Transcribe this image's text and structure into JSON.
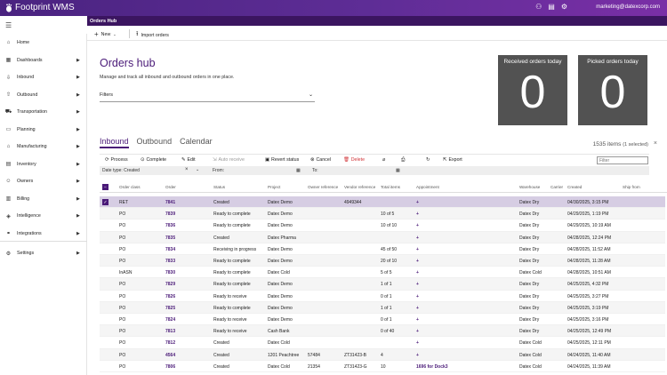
{
  "app": {
    "title": "Footprint WMS",
    "email": "marketing@datexcorp.com"
  },
  "topicons": [
    "user-switch-icon",
    "document-icon",
    "gear-icon"
  ],
  "page_header": "Orders Hub",
  "sidebar": {
    "items": [
      {
        "label": "Home",
        "icon": "home-icon",
        "arrow": false
      },
      {
        "label": "Dashboards",
        "icon": "dashboard-icon",
        "arrow": true
      },
      {
        "label": "Inbound",
        "icon": "inbound-icon",
        "arrow": true
      },
      {
        "label": "Outbound",
        "icon": "outbound-icon",
        "arrow": true
      },
      {
        "label": "Transportation",
        "icon": "truck-icon",
        "arrow": true
      },
      {
        "label": "Planning",
        "icon": "planning-icon",
        "arrow": true
      },
      {
        "label": "Manufacturing",
        "icon": "factory-icon",
        "arrow": true
      },
      {
        "label": "Inventory",
        "icon": "inventory-icon",
        "arrow": true
      },
      {
        "label": "Owners",
        "icon": "owners-icon",
        "arrow": true
      },
      {
        "label": "Billing",
        "icon": "billing-icon",
        "arrow": true
      },
      {
        "label": "Intelligence",
        "icon": "intelligence-icon",
        "arrow": true
      },
      {
        "label": "Integrations",
        "icon": "integrations-icon",
        "arrow": true
      },
      {
        "label": "Settings",
        "icon": "gear-icon",
        "arrow": true
      }
    ]
  },
  "toolbar": {
    "new_label": "New",
    "import_label": "Import orders"
  },
  "hub": {
    "title": "Orders hub",
    "description": "Manage and track all inbound and outbound orders in one place.",
    "filters_label": "Filters"
  },
  "cards": [
    {
      "title": "Received orders today",
      "value": "0"
    },
    {
      "title": "Picked orders today",
      "value": "0"
    }
  ],
  "tabs": [
    {
      "label": "Inbound",
      "active": true
    },
    {
      "label": "Outbound",
      "active": false
    },
    {
      "label": "Calendar",
      "active": false
    }
  ],
  "count": {
    "items": "1535 items",
    "selected": "(1 selected)"
  },
  "grid_toolbar": {
    "process": "Process",
    "complete": "Complete",
    "edit": "Edit",
    "auto_receive": "Auto receive",
    "revert": "Revert status",
    "cancel": "Cancel",
    "delete": "Delete",
    "export": "Export",
    "filter_placeholder": "Filter"
  },
  "criteria": {
    "date_type": "Date type: Created",
    "from": "From:",
    "to": "To:"
  },
  "columns": [
    "Order class",
    "Order",
    "Status",
    "Project",
    "Owner reference",
    "Vendor reference",
    "Total items",
    "Appointment",
    "Warehouse",
    "Carrier",
    "Created",
    "Ship from"
  ],
  "rows": [
    {
      "cls": "RET",
      "order": "7841",
      "status": "Created",
      "project": "Datex Demo",
      "owner_ref": "",
      "vendor_ref": "4949344",
      "items": "",
      "appt": "+",
      "wh": "Datex Dry",
      "created": "04/30/2025, 3:15 PM",
      "selected": true
    },
    {
      "cls": "PO",
      "order": "7839",
      "status": "Ready to complete",
      "project": "Datex Demo",
      "owner_ref": "",
      "vendor_ref": "",
      "items": "10 of 5",
      "appt": "+",
      "wh": "Datex Dry",
      "created": "04/29/2025, 1:19 PM",
      "selected": false
    },
    {
      "cls": "PO",
      "order": "7836",
      "status": "Ready to complete",
      "project": "Datex Demo",
      "owner_ref": "",
      "vendor_ref": "",
      "items": "10 of 10",
      "appt": "+",
      "wh": "Datex Dry",
      "created": "04/29/2025, 10:19 AM",
      "selected": false
    },
    {
      "cls": "PO",
      "order": "7835",
      "status": "Created",
      "project": "Datex Pharma",
      "owner_ref": "",
      "vendor_ref": "",
      "items": "",
      "appt": "+",
      "wh": "Datex Dry",
      "created": "04/28/2025, 12:24 PM",
      "selected": false
    },
    {
      "cls": "PO",
      "order": "7834",
      "status": "Receiving in progress",
      "project": "Datex Demo",
      "owner_ref": "",
      "vendor_ref": "",
      "items": "45 of 50",
      "appt": "+",
      "wh": "Datex Dry",
      "created": "04/28/2025, 11:52 AM",
      "selected": false
    },
    {
      "cls": "PO",
      "order": "7833",
      "status": "Ready to complete",
      "project": "Datex Demo",
      "owner_ref": "",
      "vendor_ref": "",
      "items": "20 of 10",
      "appt": "+",
      "wh": "Datex Dry",
      "created": "04/28/2025, 11:28 AM",
      "selected": false
    },
    {
      "cls": "InASN",
      "order": "7830",
      "status": "Ready to complete",
      "project": "Datex Cold",
      "owner_ref": "",
      "vendor_ref": "",
      "items": "5 of 5",
      "appt": "+",
      "wh": "Datex Cold",
      "created": "04/28/2025, 10:51 AM",
      "selected": false
    },
    {
      "cls": "PO",
      "order": "7829",
      "status": "Ready to complete",
      "project": "Datex Demo",
      "owner_ref": "",
      "vendor_ref": "",
      "items": "1 of 1",
      "appt": "+",
      "wh": "Datex Dry",
      "created": "04/25/2025, 4:32 PM",
      "selected": false
    },
    {
      "cls": "PO",
      "order": "7826",
      "status": "Ready to receive",
      "project": "Datex Demo",
      "owner_ref": "",
      "vendor_ref": "",
      "items": "0 of 1",
      "appt": "+",
      "wh": "Datex Dry",
      "created": "04/25/2025, 3:27 PM",
      "selected": false
    },
    {
      "cls": "PO",
      "order": "7825",
      "status": "Ready to complete",
      "project": "Datex Demo",
      "owner_ref": "",
      "vendor_ref": "",
      "items": "1 of 1",
      "appt": "+",
      "wh": "Datex Dry",
      "created": "04/25/2025, 3:19 PM",
      "selected": false
    },
    {
      "cls": "PO",
      "order": "7824",
      "status": "Ready to receive",
      "project": "Datex Demo",
      "owner_ref": "",
      "vendor_ref": "",
      "items": "0 of 1",
      "appt": "+",
      "wh": "Datex Dry",
      "created": "04/25/2025, 3:16 PM",
      "selected": false
    },
    {
      "cls": "PO",
      "order": "7813",
      "status": "Ready to receive",
      "project": "Cash Bank",
      "owner_ref": "",
      "vendor_ref": "",
      "items": "0 of 40",
      "appt": "+",
      "wh": "Datex Dry",
      "created": "04/25/2025, 12:49 PM",
      "selected": false
    },
    {
      "cls": "PO",
      "order": "7812",
      "status": "Created",
      "project": "Datex Cold",
      "owner_ref": "",
      "vendor_ref": "",
      "items": "",
      "appt": "+",
      "wh": "Datex Cold",
      "created": "04/25/2025, 12:11 PM",
      "selected": false
    },
    {
      "cls": "PO",
      "order": "4564",
      "status": "Created",
      "project": "1201 Peachtree",
      "owner_ref": "57484",
      "vendor_ref": "ZT31423-B",
      "items": "4",
      "appt": "+",
      "wh": "Datex Cold",
      "created": "04/24/2025, 11:40 AM",
      "selected": false
    },
    {
      "cls": "PO",
      "order": "7806",
      "status": "Created",
      "project": "Datex Cold",
      "owner_ref": "21354",
      "vendor_ref": "ZT31423-G",
      "items": "10",
      "appt": "1696 for Dock3",
      "wh": "Datex Cold",
      "created": "04/24/2025, 11:39 AM",
      "selected": false
    }
  ]
}
